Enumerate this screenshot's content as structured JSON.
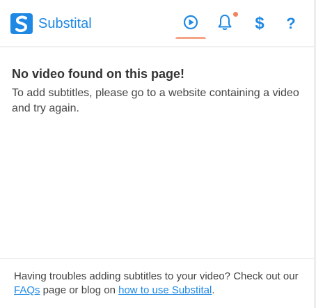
{
  "app": {
    "name": "Substital",
    "brand_color": "#1e88e5",
    "accent_color": "#f0845c"
  },
  "nav": {
    "items": [
      {
        "name": "video",
        "icon": "play-circle-icon",
        "active": true
      },
      {
        "name": "notifications",
        "icon": "bell-icon",
        "has_badge": true
      },
      {
        "name": "donate",
        "icon": "dollar-icon",
        "label": "$"
      },
      {
        "name": "help",
        "icon": "question-icon",
        "label": "?"
      }
    ]
  },
  "main": {
    "title": "No video found on this page!",
    "message": "To add subtitles, please go to a website containing a video and try again."
  },
  "footer": {
    "text_before": "Having troubles adding subtitles to your video? Check out our ",
    "faq_link": "FAQs",
    "text_middle": " page or blog on ",
    "howto_link": "how to use Substital",
    "text_after": "."
  }
}
